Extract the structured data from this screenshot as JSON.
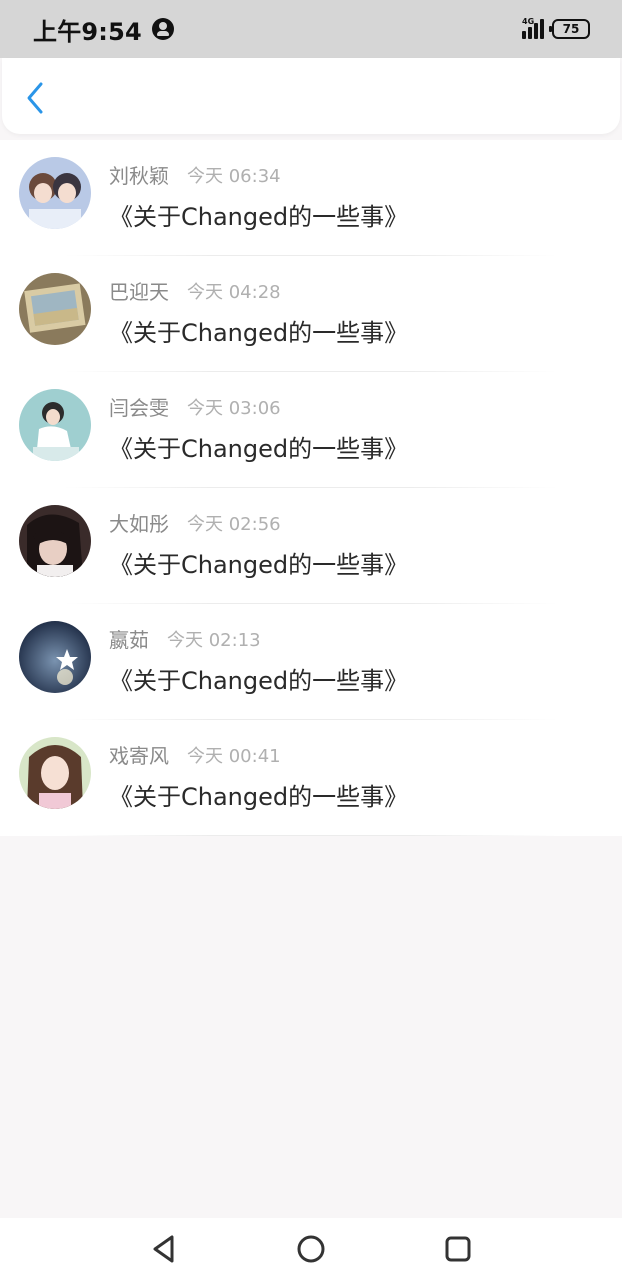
{
  "status_bar": {
    "time": "上午9:54",
    "network": "4G",
    "battery": "75"
  },
  "header": {
    "back_icon": "chevron-left-icon",
    "accent_color": "#2a95e8"
  },
  "items": [
    {
      "name": "刘秋颖",
      "time": "今天 06:34",
      "title": "《关于Changed的一些事》"
    },
    {
      "name": "巴迎天",
      "time": "今天 04:28",
      "title": "《关于Changed的一些事》"
    },
    {
      "name": "闫会雯",
      "time": "今天 03:06",
      "title": "《关于Changed的一些事》"
    },
    {
      "name": "大如彤",
      "time": "今天 02:56",
      "title": "《关于Changed的一些事》"
    },
    {
      "name": "嬴茹",
      "time": "今天 02:13",
      "title": "《关于Changed的一些事》"
    },
    {
      "name": "戏寄风",
      "time": "今天 00:41",
      "title": "《关于Changed的一些事》"
    }
  ],
  "nav_bar": {
    "back": "triangle-back-icon",
    "home": "circle-home-icon",
    "recents": "square-recents-icon"
  }
}
